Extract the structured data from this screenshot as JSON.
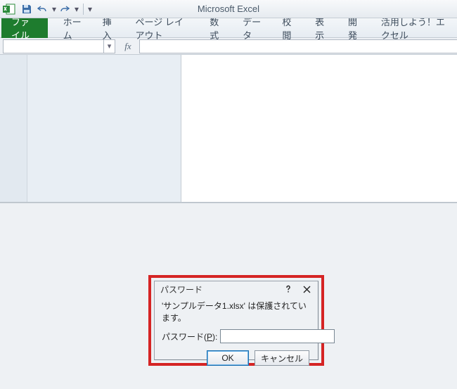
{
  "app_title": "Microsoft Excel",
  "file_tab_label": "ファイル",
  "ribbon_tabs": [
    "ホーム",
    "挿入",
    "ページ レイアウト",
    "数式",
    "データ",
    "校閲",
    "表示",
    "開発",
    "活用しよう！エクセル"
  ],
  "name_box_value": "",
  "formula_bar_value": "",
  "fx_label": "fx",
  "dialog": {
    "title": "パスワード",
    "message": "'サンプルデータ1.xlsx' は保護されています。",
    "field_label_prefix": "パスワード(",
    "field_label_hotkey": "P",
    "field_label_suffix": "):",
    "input_value": "",
    "ok_label": "OK",
    "cancel_label": "キャンセル"
  }
}
